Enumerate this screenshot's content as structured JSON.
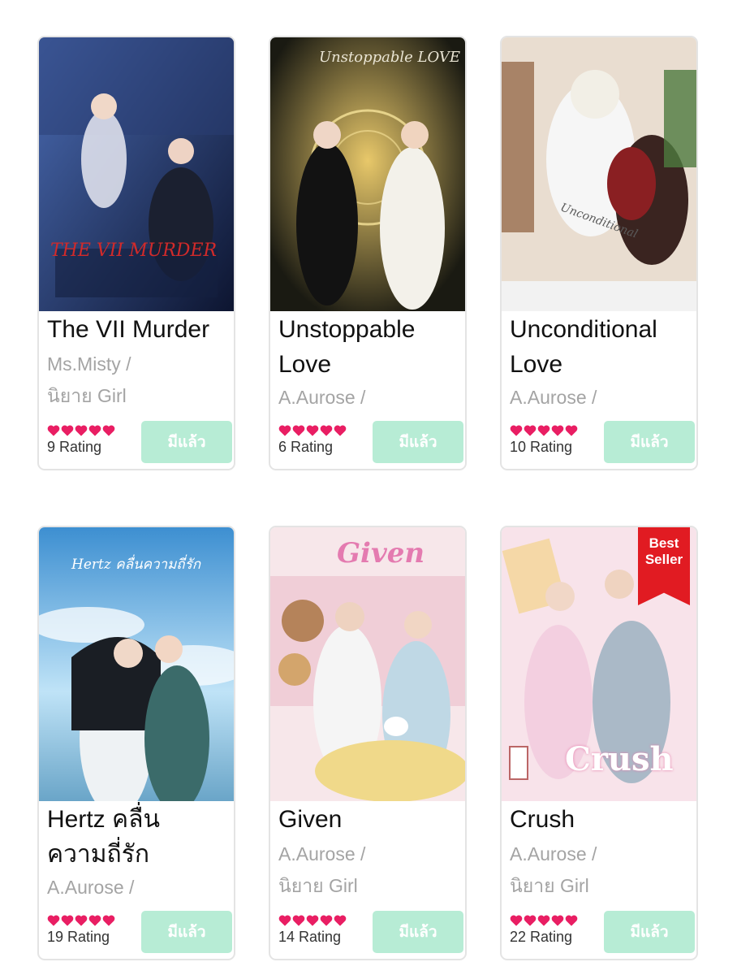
{
  "books": [
    {
      "title_line1": "The VII Murder",
      "title_line2": "",
      "author": "Ms.Misty /",
      "category": "นิยาย Girl",
      "rating_count": "9 Rating",
      "hearts": 5,
      "own_label": "มีแล้ว",
      "cover_text": "THE VII MURDER",
      "cover_colors": [
        "#1f2f5c",
        "#4a6bb3",
        "#0d1530"
      ]
    },
    {
      "title_line1": "Unstoppable",
      "title_line2": "Love",
      "author": "A.Aurose /",
      "category": "",
      "rating_count": "6 Rating",
      "hearts": 5,
      "own_label": "มีแล้ว",
      "cover_text": "Unstoppable LOVE",
      "cover_colors": [
        "#1a1a12",
        "#caa84a",
        "#2a2a22"
      ]
    },
    {
      "title_line1": "Unconditional",
      "title_line2": "Love",
      "author": "A.Aurose /",
      "category": "",
      "rating_count": "10 Rating",
      "hearts": 5,
      "own_label": "มีแล้ว",
      "cover_text": "Unconditional",
      "cover_colors": [
        "#e8dcd0",
        "#8a2a2a",
        "#f4f0ea"
      ]
    },
    {
      "title_line1": "Hertz คลื่น",
      "title_line2": "ความถี่รัก",
      "author": "A.Aurose /",
      "category": "",
      "rating_count": "19 Rating",
      "hearts": 5,
      "own_label": "มีแล้ว",
      "cover_text": "Hertz คลื่นความถี่รัก",
      "cover_colors": [
        "#3d8fd1",
        "#bfe3f7",
        "#6aa5c8"
      ]
    },
    {
      "title_line1": "Given",
      "title_line2": "",
      "author": "A.Aurose /",
      "category": "นิยาย Girl",
      "rating_count": "14 Rating",
      "hearts": 5,
      "own_label": "มีแล้ว",
      "cover_text": "Given",
      "cover_colors": [
        "#f3d5dc",
        "#e8a3b6",
        "#fbeff1"
      ]
    },
    {
      "title_line1": "Crush",
      "title_line2": "",
      "author": "A.Aurose /",
      "category": "นิยาย Girl",
      "rating_count": "22 Rating",
      "hearts": 5,
      "own_label": "มีแล้ว",
      "cover_text": "Crush",
      "cover_colors": [
        "#f6dde6",
        "#e7a7c2",
        "#fdf2f6"
      ],
      "badge": "Best Seller"
    }
  ],
  "colors": {
    "heart": "#e91e63",
    "own_button_bg": "#b7ecd5",
    "badge_red": "#e11b22"
  }
}
